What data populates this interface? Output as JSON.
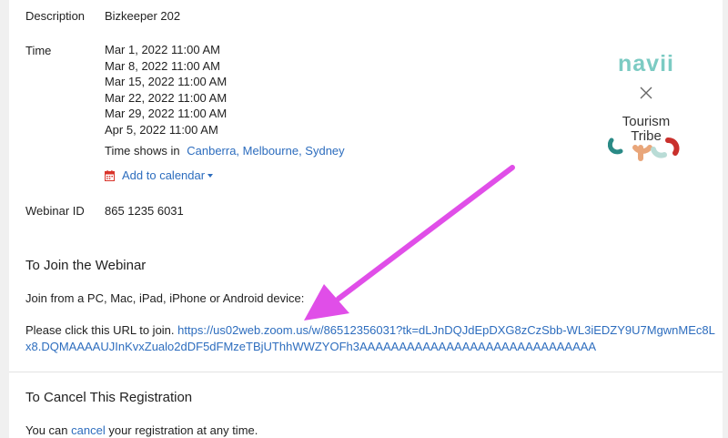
{
  "details": {
    "description_label": "Description",
    "description_value": "Bizkeeper 202",
    "time_label": "Time",
    "times": [
      "Mar 1, 2022 11:00 AM",
      "Mar 8, 2022 11:00 AM",
      "Mar 15, 2022 11:00 AM",
      "Mar 22, 2022 11:00 AM",
      "Mar 29, 2022 11:00 AM",
      "Apr 5, 2022 11:00 AM"
    ],
    "time_shows_in": "Time shows in",
    "timezone_link": "Canberra, Melbourne, Sydney",
    "add_to_calendar": "Add to calendar",
    "webinar_id_label": "Webinar ID",
    "webinar_id_value": "865 1235 6031"
  },
  "join": {
    "heading": "To Join the Webinar",
    "devices_text": "Join from a PC, Mac, iPad, iPhone or Android device:",
    "click_prefix": "Please click this URL to join.",
    "url": "https://us02web.zoom.us/w/86512356031?tk=dLJnDQJdEpDXG8zCzSbb-WL3iEDZY9U7MgwnMEc8Lx8.DQMAAAAUJInKvxZualo2dDF5dFMzeTBjUThhWWZYOFh3AAAAAAAAAAAAAAAAAAAAAAAAAAAAAA"
  },
  "cancel": {
    "heading": "To Cancel This Registration",
    "prefix": "You can",
    "link": "cancel",
    "suffix": "your registration at any time."
  },
  "logo": {
    "brand": "navii",
    "partner_line1": "Tourism",
    "partner_line2": "Tribe"
  },
  "colors": {
    "link": "#2d6dbe",
    "arrow": "#e04ee8",
    "navii": "#7ccbc3",
    "calendar_icon": "#d9342b"
  }
}
